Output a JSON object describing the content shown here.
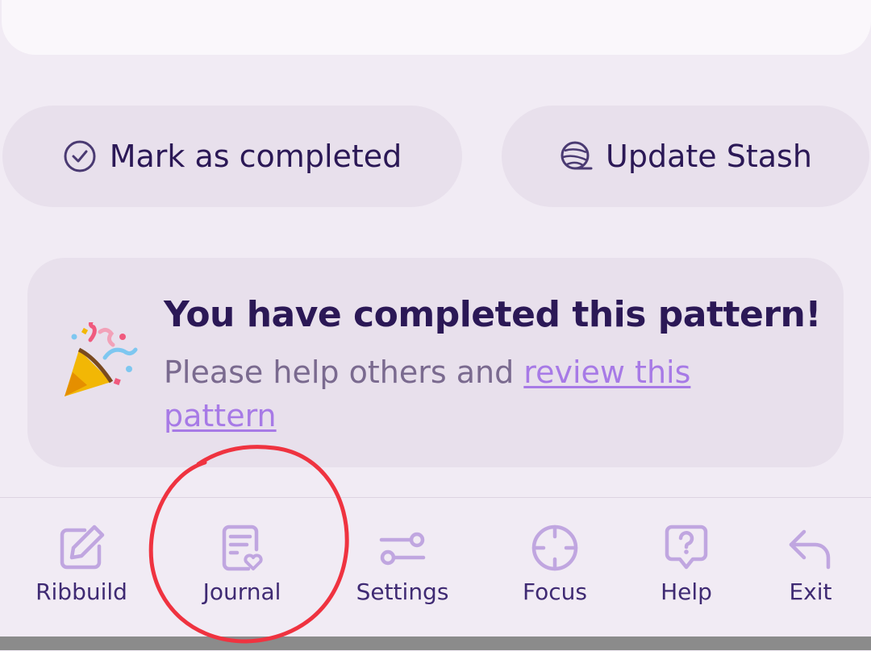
{
  "actions": {
    "mark_completed": {
      "label": "Mark as completed",
      "icon": "check-circle-icon"
    },
    "update_stash": {
      "label": "Update Stash",
      "icon": "yarn-ball-icon"
    }
  },
  "notice": {
    "icon": "party-popper-icon",
    "title": "You have completed this pattern!",
    "body_prefix": "Please help others and ",
    "link_text": "review this pattern"
  },
  "nav": {
    "items": [
      {
        "label": "Ribbuild",
        "icon": "edit-icon"
      },
      {
        "label": "Journal",
        "icon": "journal-icon"
      },
      {
        "label": "Settings",
        "icon": "settings-toggle-icon"
      },
      {
        "label": "Focus",
        "icon": "crosshair-icon"
      },
      {
        "label": "Help",
        "icon": "help-bubble-icon"
      },
      {
        "label": "Exit",
        "icon": "exit-arrow-icon"
      }
    ]
  },
  "colors": {
    "background": "#f1ebf4",
    "card": "#e8e0ec",
    "text_primary": "#2b1856",
    "text_secondary": "#7a6a8f",
    "link": "#a77ae6",
    "nav_icon": "#c0a6e0",
    "annotation": "#ef3340"
  }
}
